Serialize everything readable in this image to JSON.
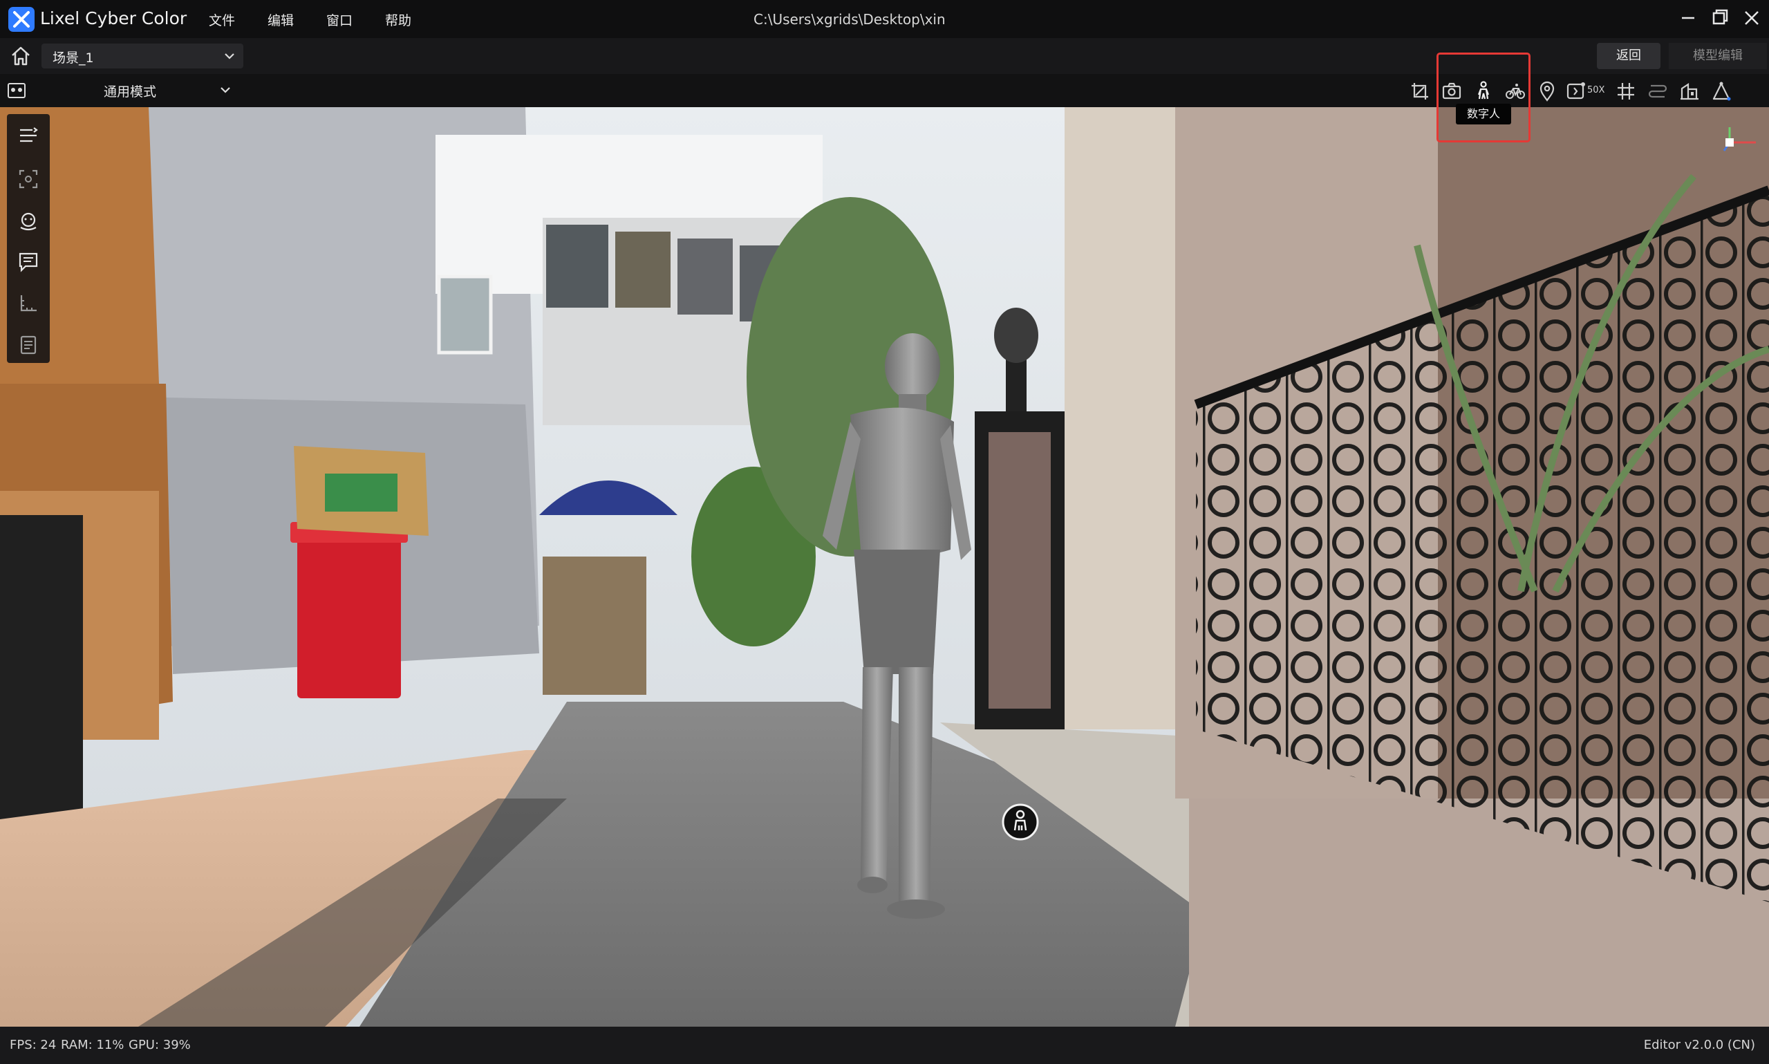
{
  "app": {
    "name": "Lixel Cyber Color",
    "path": "C:\\Users\\xgrids\\Desktop\\xin"
  },
  "menu": {
    "file": "文件",
    "edit": "编辑",
    "window": "窗口",
    "help": "帮助"
  },
  "toolbar": {
    "scene_select": "场景_1",
    "mode_select": "通用模式",
    "back_button": "返回",
    "model_edit_button": "模型编辑",
    "speed_label": "50X",
    "tooltip": "数字人"
  },
  "status": {
    "fps": "FPS: 24",
    "ram": "RAM: 11%",
    "gpu": "GPU: 39%",
    "version": "Editor v2.0.0 (CN)"
  },
  "colors": {
    "highlight": "#e53935",
    "accent": "#2f7bff"
  }
}
